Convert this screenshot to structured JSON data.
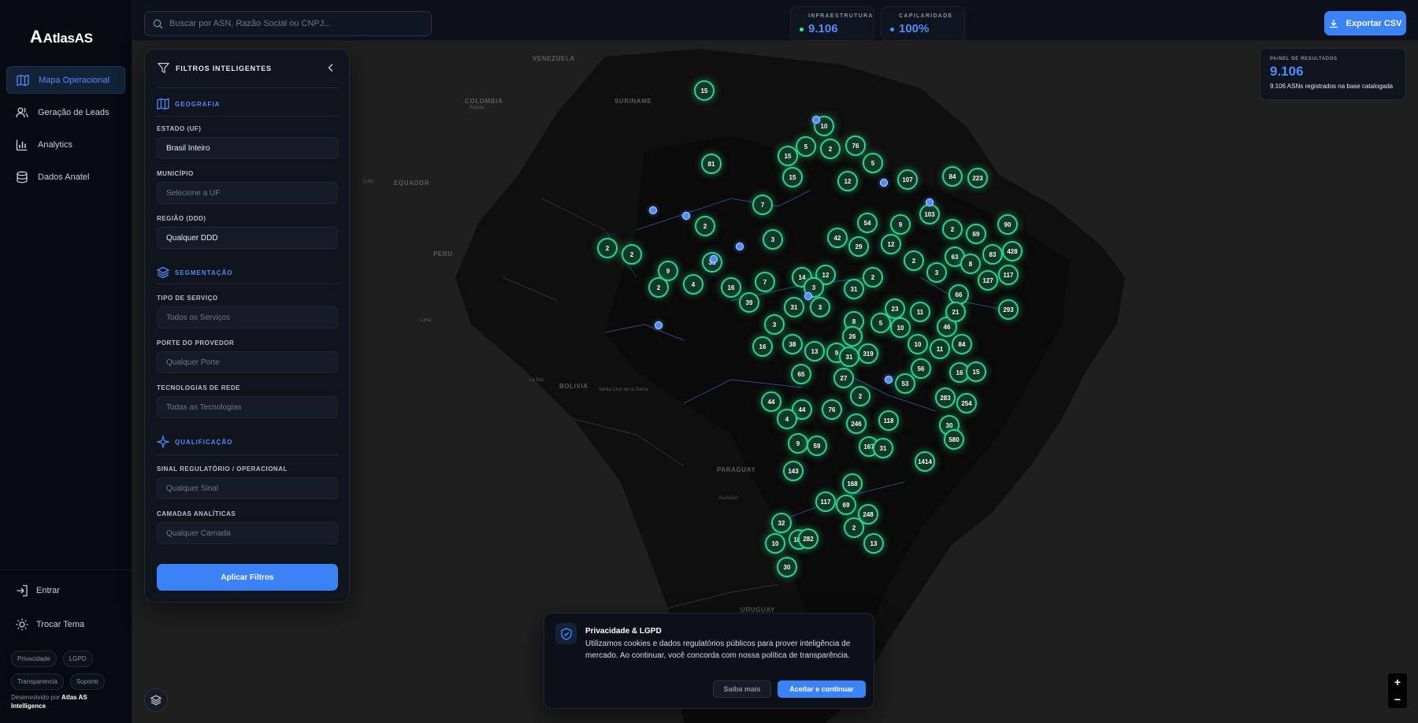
{
  "app": {
    "logo_mark": "A",
    "logo_text": "AtlasAS"
  },
  "sidebar": {
    "items": [
      {
        "label": "Mapa Operacional",
        "icon": "map-icon"
      },
      {
        "label": "Geração de Leads",
        "icon": "users-icon"
      },
      {
        "label": "Analytics",
        "icon": "bar-chart-icon"
      },
      {
        "label": "Dados Anatel",
        "icon": "database-icon"
      }
    ],
    "login": "Entrar",
    "theme": "Trocar Tema",
    "links": [
      "Privacidade",
      "LGPD",
      "Transparencia",
      "Suporte"
    ],
    "credits_prefix": "Desenvolvido por",
    "credits_name": "Atlas AS Intelligence"
  },
  "topbar": {
    "search_placeholder": "Buscar por ASN, Razão Social ou CNPJ...",
    "stats": [
      {
        "label": "INFRAESTRUTURA",
        "value": "9.106"
      },
      {
        "label": "CAPILARIDADE",
        "value": "100%"
      }
    ],
    "export_label": "Exportar CSV"
  },
  "filters": {
    "title": "FILTROS INTELIGENTES",
    "sections": {
      "geo": "GEOGRAFIA",
      "seg": "SEGMENTAÇÃO",
      "qual": "QUALIFICAÇÃO"
    },
    "fields": {
      "estado_label": "ESTADO (UF)",
      "estado_value": "Brasil Inteiro",
      "municipio_label": "MUNICÍPIO",
      "municipio_placeholder": "Selecione a UF",
      "regiao_label": "REGIÃO (DDD)",
      "regiao_value": "Qualquer DDD",
      "servico_label": "TIPO DE SERVIÇO",
      "servico_placeholder": "Todos os Serviços",
      "porte_label": "PORTE DO PROVEDOR",
      "porte_placeholder": "Qualquer Porte",
      "tec_label": "TECNOLOGIAS DE REDE",
      "tec_placeholder": "Todas as Tecnologias",
      "sinal_label": "SINAL REGULATÓRIO / OPERACIONAL",
      "sinal_placeholder": "Qualquer Sinal",
      "camadas_label": "CAMADAS ANALÍTICAS",
      "camadas_placeholder": "Qualquer Camada"
    },
    "apply_label": "Aplicar Filtros"
  },
  "results": {
    "title": "PAINEL DE RESULTADOS",
    "value": "9.106",
    "subtitle": "9.106 ASNs registrados na base catalogada"
  },
  "cookie": {
    "title": "Privacidade & LGPD",
    "text": "Utilizamos cookies e dados regulatórios públicos para prover inteligência de mercado. Ao continuar, você concorda com nossa política de transparência.",
    "more_label": "Saiba mais",
    "accept_label": "Aceitar e continuar"
  },
  "map": {
    "labels": [
      "VENEZUELA",
      "COLOMBIA",
      "SURINAME",
      "EQUADOR",
      "PERU",
      "BOLIVIA",
      "PARAGUAY",
      "URUGUAY",
      "Bogota",
      "Quito",
      "Lima",
      "La Paz",
      "Santa Cruz de la Sierra",
      "Asuncion"
    ],
    "clusters": [
      "15",
      "10",
      "5",
      "2",
      "76",
      "15",
      "81",
      "15",
      "12",
      "5",
      "107",
      "84",
      "223",
      "7",
      "2",
      "54",
      "9",
      "103",
      "2",
      "69",
      "90",
      "3",
      "42",
      "29",
      "12",
      "2",
      "63",
      "8",
      "83",
      "428",
      "2",
      "2",
      "33",
      "9",
      "3",
      "12",
      "2",
      "117",
      "4",
      "16",
      "7",
      "14",
      "3",
      "31",
      "127",
      "2",
      "39",
      "31",
      "23",
      "11",
      "66",
      "3",
      "3",
      "5",
      "10",
      "46",
      "21",
      "293",
      "8",
      "16",
      "38",
      "13",
      "9",
      "31",
      "319",
      "26",
      "10",
      "11",
      "84",
      "56",
      "16",
      "15",
      "44",
      "65",
      "27",
      "2",
      "53",
      "283",
      "254",
      "44",
      "4",
      "76",
      "246",
      "118",
      "30",
      "9",
      "59",
      "167",
      "31",
      "1414",
      "580",
      "143",
      "168",
      "117",
      "69",
      "248",
      "32",
      "2",
      "102",
      "282",
      "13",
      "10",
      "30"
    ],
    "zoom_in": "+",
    "zoom_out": "−"
  }
}
